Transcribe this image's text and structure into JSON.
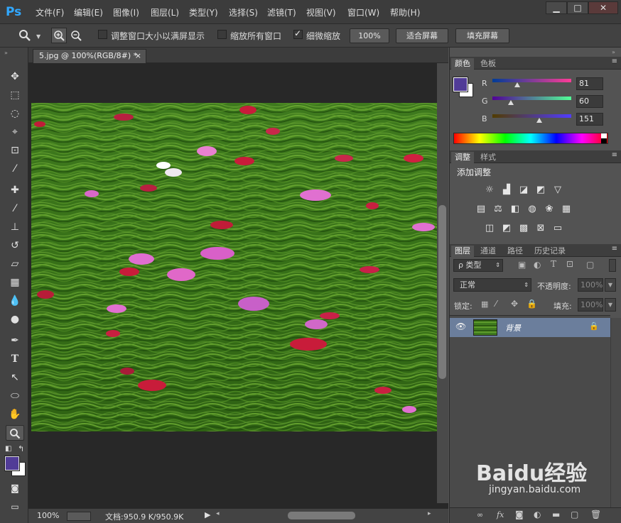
{
  "app": {
    "logo": "Ps"
  },
  "menu": [
    {
      "label": "文件(F)"
    },
    {
      "label": "编辑(E)"
    },
    {
      "label": "图像(I)"
    },
    {
      "label": "图层(L)"
    },
    {
      "label": "类型(Y)"
    },
    {
      "label": "选择(S)"
    },
    {
      "label": "滤镜(T)"
    },
    {
      "label": "视图(V)"
    },
    {
      "label": "窗口(W)"
    },
    {
      "label": "帮助(H)"
    }
  ],
  "window_controls": {
    "minimize": "▁",
    "maximize": "□",
    "close": "✕"
  },
  "options": {
    "resize_windows_label": "调整窗口大小以满屏显示",
    "resize_windows_checked": false,
    "zoom_all_label": "缩放所有窗口",
    "zoom_all_checked": false,
    "scrubby_zoom_label": "细微缩放",
    "scrubby_zoom_checked": true,
    "pct_button": "100%",
    "fit_screen_button": "适合屏幕",
    "fill_screen_button": "填充屏幕"
  },
  "document": {
    "tab_title": "5.jpg @ 100%(RGB/8#) *",
    "tab_close": "×"
  },
  "status": {
    "zoom": "100%",
    "doc_info": "文档:950.9 K/950.9K"
  },
  "color_panel": {
    "tabs": [
      "颜色",
      "色板"
    ],
    "fg_color": "#513c97",
    "bg_color": "#ffffff",
    "r_label": "R",
    "r_value": "81",
    "g_label": "G",
    "g_value": "60",
    "b_label": "B",
    "b_value": "151"
  },
  "adjust_panel": {
    "tabs": [
      "调整",
      "样式"
    ],
    "title": "添加调整"
  },
  "layers_panel": {
    "tabs": [
      "图层",
      "通道",
      "路径",
      "历史记录"
    ],
    "filter_kind": "ρ 类型",
    "blend_mode": "正常",
    "opacity_label": "不透明度:",
    "opacity_value": "100%",
    "lock_label": "锁定:",
    "fill_label": "填充:",
    "fill_value": "100%",
    "layers": [
      {
        "name": "背景",
        "visible": true,
        "locked": true
      }
    ]
  },
  "watermark": {
    "brand": "Baidu经验",
    "url": "jingyan.baidu.com"
  }
}
